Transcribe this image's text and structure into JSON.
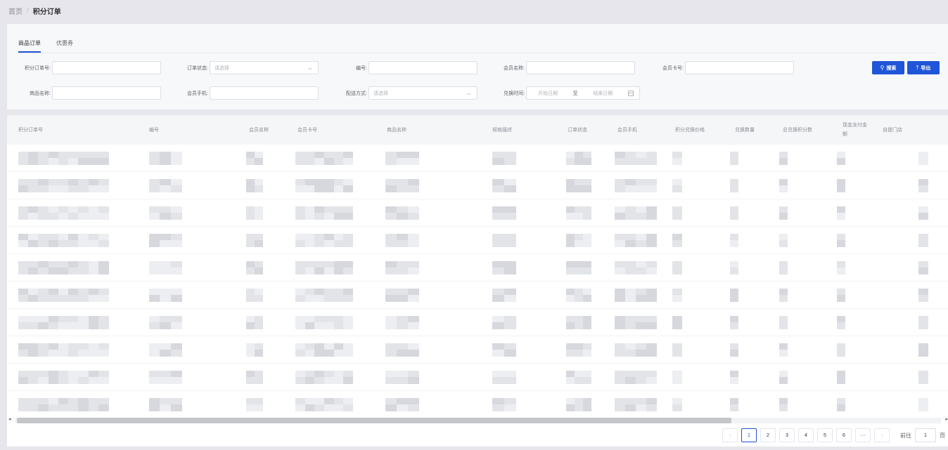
{
  "breadcrumb": {
    "home": "首页",
    "separator": "/",
    "current": "积分订单"
  },
  "tabs": [
    {
      "label": "商品订单",
      "active": true
    },
    {
      "label": "优惠券",
      "active": false
    }
  ],
  "filters": {
    "order_no": {
      "label": "积分订单号:",
      "value": ""
    },
    "order_status": {
      "label": "订单状态:",
      "placeholder": "请选择"
    },
    "code": {
      "label": "编号:",
      "value": ""
    },
    "member_name": {
      "label": "会员名称:",
      "value": ""
    },
    "member_card": {
      "label": "会员卡号:",
      "value": ""
    },
    "product_name": {
      "label": "商品名称:",
      "value": ""
    },
    "member_phone": {
      "label": "会员手机:",
      "value": ""
    },
    "delivery": {
      "label": "配送方式:",
      "placeholder": "请选择"
    },
    "exchange_time": {
      "label": "兑换时间:",
      "start_placeholder": "开始日期",
      "to": "至",
      "end_placeholder": "结束日期"
    }
  },
  "actions": {
    "search_label": "搜索",
    "export_label": "导出"
  },
  "table": {
    "columns": [
      "积分订单号",
      "编号",
      "会员名称",
      "会员卡号",
      "商品名称",
      "规格描述",
      "订单状态",
      "会员手机",
      "积分兑换价格",
      "兑换数量",
      "总兑换积分数",
      "现金支付金额",
      "自提门店"
    ],
    "row_count": 10
  },
  "pagination": {
    "pages": [
      "1",
      "2",
      "3",
      "4",
      "5",
      "6"
    ],
    "current": 1,
    "ellipsis": "···",
    "prev": "‹",
    "next": "›",
    "goto_label": "前往",
    "goto_value": "1",
    "page_unit": "页"
  },
  "colors": {
    "primary": "#1f55d8",
    "background": "#e6e6ec"
  }
}
